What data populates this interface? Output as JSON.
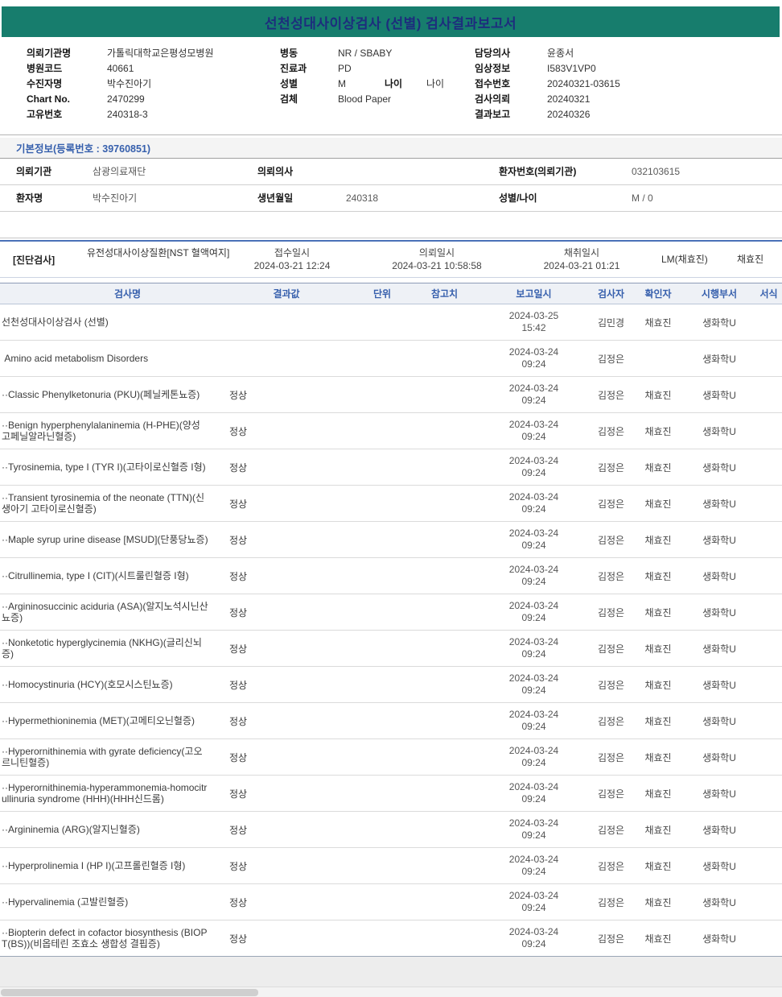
{
  "title": "선천성대사이상검사 (선별) 검사결과보고서",
  "colors": {
    "banner-bg": "#177d6d",
    "title-text": "#1d2d7d",
    "accent-blue": "#3760ad"
  },
  "header_fields": {
    "col1": [
      {
        "label": "의뢰기관명",
        "value": "가톨릭대학교은평성모병원"
      },
      {
        "label": "병원코드",
        "value": "40661"
      },
      {
        "label": "수진자명",
        "value": "박수진아기"
      },
      {
        "label": "Chart No.",
        "value": "2470299"
      },
      {
        "label": "고유번호",
        "value": "240318-3"
      }
    ],
    "col2": [
      {
        "label": "병동",
        "value": "NR / SBABY"
      },
      {
        "label": "진료과",
        "value": "PD"
      },
      {
        "label": "성별",
        "value": "M",
        "label2": "나이",
        "value2": "나이"
      },
      {
        "label": "검체",
        "value": "Blood Paper"
      }
    ],
    "col3": [
      {
        "label": "담당의사",
        "value": "윤종서"
      },
      {
        "label": "임상정보",
        "value": "I583V1VP0"
      },
      {
        "label": "접수번호",
        "value": "20240321-03615"
      },
      {
        "label": "검사의뢰",
        "value": "20240321"
      },
      {
        "label": "결과보고",
        "value": "20240326"
      }
    ]
  },
  "basic_info": {
    "title": "기본정보(등록번호 : 39760851)",
    "rows": [
      [
        {
          "label": "의뢰기관",
          "value": "삼광의료재단"
        },
        {
          "label": "의뢰의사",
          "value": ""
        },
        {
          "label": "환자번호(의뢰기관)",
          "value": "032103615"
        }
      ],
      [
        {
          "label": "환자명",
          "value": "박수진아기"
        },
        {
          "label": "생년월일",
          "value": "240318"
        },
        {
          "label": "성별/나이",
          "value": "M / 0"
        }
      ]
    ]
  },
  "diagnostic": {
    "section_label": "[진단검사]",
    "test_name": "유전성대사이상질환[NST 혈액여지]",
    "fields": [
      {
        "label": "접수일시",
        "value": "2024-03-21 12:24"
      },
      {
        "label": "의뢰일시",
        "value": "2024-03-21 10:58:58"
      },
      {
        "label": "채취일시",
        "value": "2024-03-21 01:21"
      }
    ],
    "collector": "LM(채효진)",
    "confirmer": "채효진"
  },
  "results_table": {
    "headers": [
      "검사명",
      "결과값",
      "단위",
      "참고치",
      "보고일시",
      "검사자",
      "확인자",
      "시행부서",
      "서식"
    ],
    "rows": [
      {
        "name": "선천성대사이상검사 (선별)",
        "result": "",
        "date": "2024-03-25",
        "time": "15:42",
        "tester": "김민경",
        "confirmer": "채효진",
        "dept": "생화학U"
      },
      {
        "name": " Amino acid metabolism Disorders",
        "result": "",
        "date": "2024-03-24",
        "time": "09:24",
        "tester": "김정은",
        "confirmer": "",
        "dept": "생화학U"
      },
      {
        "name": "··Classic Phenylketonuria (PKU)(페닐케톤뇨증)",
        "result": "정상",
        "date": "2024-03-24",
        "time": "09:24",
        "tester": "김정은",
        "confirmer": "채효진",
        "dept": "생화학U"
      },
      {
        "name": "··Benign hyperphenylalaninemia (H-PHE)(양성 고페닐알라닌혈증)",
        "result": "정상",
        "date": "2024-03-24",
        "time": "09:24",
        "tester": "김정은",
        "confirmer": "채효진",
        "dept": "생화학U"
      },
      {
        "name": "··Tyrosinemia, type I (TYR I)(고타이로신혈증 I형)",
        "result": "정상",
        "date": "2024-03-24",
        "time": "09:24",
        "tester": "김정은",
        "confirmer": "채효진",
        "dept": "생화학U"
      },
      {
        "name": "··Transient tyrosinemia of the neonate (TTN)(신생아기 고타이로신혈증)",
        "result": "정상",
        "date": "2024-03-24",
        "time": "09:24",
        "tester": "김정은",
        "confirmer": "채효진",
        "dept": "생화학U"
      },
      {
        "name": "··Maple syrup urine disease [MSUD](단풍당뇨증)",
        "result": "정상",
        "date": "2024-03-24",
        "time": "09:24",
        "tester": "김정은",
        "confirmer": "채효진",
        "dept": "생화학U"
      },
      {
        "name": "··Citrullinemia, type I (CIT)(시트룰린혈증 I형)",
        "result": "정상",
        "date": "2024-03-24",
        "time": "09:24",
        "tester": "김정은",
        "confirmer": "채효진",
        "dept": "생화학U"
      },
      {
        "name": "··Argininosuccinic aciduria (ASA)(알지노석시닌산뇨증)",
        "result": "정상",
        "date": "2024-03-24",
        "time": "09:24",
        "tester": "김정은",
        "confirmer": "채효진",
        "dept": "생화학U"
      },
      {
        "name": "··Nonketotic hyperglycinemia (NKHG)(글리신뇌증)",
        "result": "정상",
        "date": "2024-03-24",
        "time": "09:24",
        "tester": "김정은",
        "confirmer": "채효진",
        "dept": "생화학U"
      },
      {
        "name": "··Homocystinuria (HCY)(호모시스틴뇨증)",
        "result": "정상",
        "date": "2024-03-24",
        "time": "09:24",
        "tester": "김정은",
        "confirmer": "채효진",
        "dept": "생화학U"
      },
      {
        "name": "··Hypermethioninemia (MET)(고메티오닌혈증)",
        "result": "정상",
        "date": "2024-03-24",
        "time": "09:24",
        "tester": "김정은",
        "confirmer": "채효진",
        "dept": "생화학U"
      },
      {
        "name": "··Hyperornithinemia with gyrate deficiency(고오르니틴혈증)",
        "result": "정상",
        "date": "2024-03-24",
        "time": "09:24",
        "tester": "김정은",
        "confirmer": "채효진",
        "dept": "생화학U"
      },
      {
        "name": "··Hyperornithinemia-hyperammonemia-homocitrullinuria syndrome (HHH)(HHH신드롬)",
        "result": "정상",
        "date": "2024-03-24",
        "time": "09:24",
        "tester": "김정은",
        "confirmer": "채효진",
        "dept": "생화학U"
      },
      {
        "name": "··Argininemia (ARG)(알지닌혈증)",
        "result": "정상",
        "date": "2024-03-24",
        "time": "09:24",
        "tester": "김정은",
        "confirmer": "채효진",
        "dept": "생화학U"
      },
      {
        "name": "··Hyperprolinemia I (HP I)(고프롤린혈증 I형)",
        "result": "정상",
        "date": "2024-03-24",
        "time": "09:24",
        "tester": "김정은",
        "confirmer": "채효진",
        "dept": "생화학U"
      },
      {
        "name": "··Hypervalinemia (고발린혈증)",
        "result": "정상",
        "date": "2024-03-24",
        "time": "09:24",
        "tester": "김정은",
        "confirmer": "채효진",
        "dept": "생화학U"
      },
      {
        "name": "··Biopterin defect in cofactor biosynthesis (BIOPT(BS))(비옵테린 조효소 생합성 결핍증)",
        "result": "정상",
        "date": "2024-03-24",
        "time": "09:24",
        "tester": "김정은",
        "confirmer": "채효진",
        "dept": "생화학U"
      }
    ]
  }
}
